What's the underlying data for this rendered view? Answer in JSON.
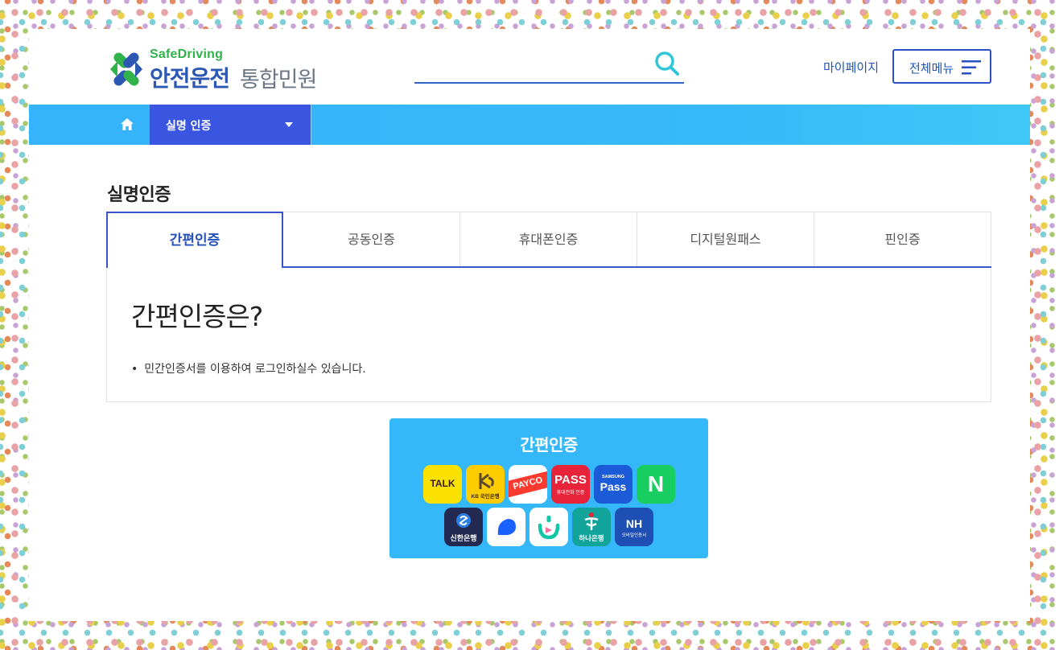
{
  "header": {
    "logo": {
      "en": "SafeDriving",
      "ko_primary": "안전운전",
      "ko_secondary": "통합민원"
    },
    "search": {
      "placeholder": ""
    },
    "mypage_label": "마이페이지",
    "allmenu_label": "전체메뉴"
  },
  "nav": {
    "dropdown_label": "실명 인증"
  },
  "page": {
    "title": "실명인증",
    "tabs": [
      {
        "label": "간편인증",
        "active": true
      },
      {
        "label": "공동인증",
        "active": false
      },
      {
        "label": "휴대폰인증",
        "active": false
      },
      {
        "label": "디지털원패스",
        "active": false
      },
      {
        "label": "핀인증",
        "active": false
      }
    ],
    "panel": {
      "heading": "간편인증은?",
      "bullet": "민간인증서를 이용하여 로그인하실수 있습니다."
    },
    "simple_auth": {
      "title": "간편인증",
      "apps": [
        {
          "icon": "kakaotalk-icon",
          "text": "TALK",
          "bg": "#fae100",
          "fg": "#3a1d1d"
        },
        {
          "icon": "kb-bank-icon",
          "text": "KB 국민은행",
          "bg": "#ffcc00",
          "fg": "#5b4a2b"
        },
        {
          "icon": "payco-icon",
          "text": "PAYCO",
          "bg": "#ffffff",
          "fg": "#ff3b30"
        },
        {
          "icon": "pass-icon",
          "text": "PASS",
          "sub": "휴대전화 인증",
          "bg": "#e8243a",
          "fg": "#ffffff"
        },
        {
          "icon": "samsung-pass-icon",
          "text": "Pass",
          "sub": "SAMSUNG",
          "bg": "#1c5bd7",
          "fg": "#ffffff"
        },
        {
          "icon": "naver-icon",
          "text": "N",
          "bg": "#19ce60",
          "fg": "#ffffff"
        },
        {
          "icon": "shinhan-bank-icon",
          "text": "신한은행",
          "bg": "#232a52",
          "fg": "#ffffff"
        },
        {
          "icon": "toss-icon",
          "text": "",
          "bg": "#ffffff",
          "fg": "#1a62ff"
        },
        {
          "icon": "banksalad-icon",
          "text": "",
          "bg": "#ffffff",
          "fg": "#11c6a7"
        },
        {
          "icon": "hana-bank-icon",
          "text": "하나은행",
          "bg": "#12a39a",
          "fg": "#ffffff"
        },
        {
          "icon": "nh-bank-icon",
          "text": "NH",
          "sub": "모바일인증서",
          "bg": "#1d4fb4",
          "fg": "#ffffff"
        }
      ]
    }
  },
  "colors": {
    "navbar": "#35b3fb",
    "dropdown": "#3a55e0",
    "primary_blue": "#2552b8",
    "simple_box": "#35b8fa"
  }
}
